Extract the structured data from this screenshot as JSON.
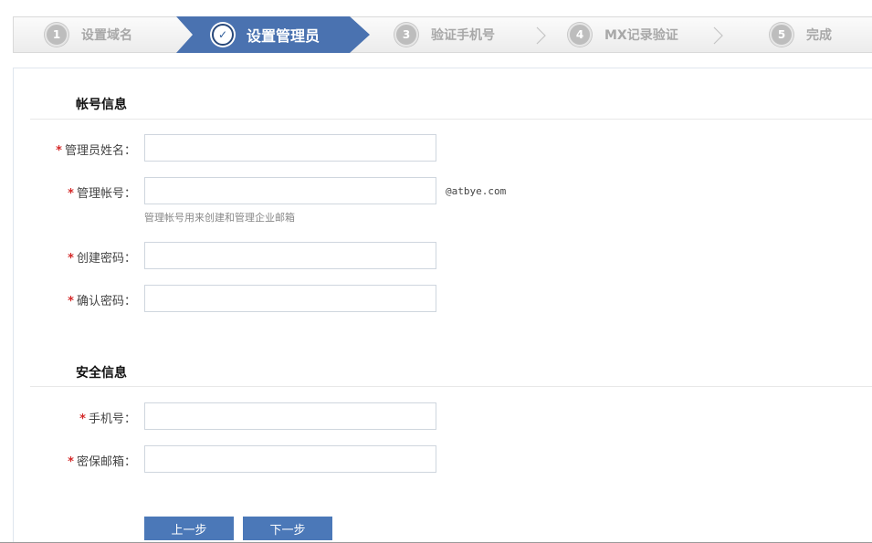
{
  "wizard": {
    "steps": [
      {
        "number": "1",
        "label": "设置域名",
        "state": "done"
      },
      {
        "number": "✓",
        "label": "设置管理员",
        "state": "active"
      },
      {
        "number": "3",
        "label": "验证手机号",
        "state": "pending"
      },
      {
        "number": "4",
        "label": "MX记录验证",
        "state": "pending"
      },
      {
        "number": "5",
        "label": "完成",
        "state": "pending"
      }
    ]
  },
  "account_section": {
    "title": "帐号信息",
    "fields": {
      "admin_name": {
        "label": "管理员姓名：",
        "value": "",
        "placeholder": ""
      },
      "admin_account": {
        "label": "管理帐号：",
        "value": "",
        "placeholder": "",
        "suffix": "@atbye.com",
        "hint": "管理帐号用来创建和管理企业邮箱"
      },
      "password": {
        "label": "创建密码：",
        "value": "",
        "placeholder": ""
      },
      "confirm_password": {
        "label": "确认密码：",
        "value": "",
        "placeholder": ""
      }
    }
  },
  "security_section": {
    "title": "安全信息",
    "fields": {
      "phone": {
        "label": "手机号：",
        "value": "",
        "placeholder": ""
      },
      "security_email": {
        "label": "密保邮箱：",
        "value": "",
        "placeholder": ""
      }
    }
  },
  "buttons": {
    "prev": "上一步",
    "next": "下一步"
  },
  "required_mark": "*",
  "colors": {
    "accent": "#4a72b0",
    "button": "#4b78b8",
    "required": "#d42a2a",
    "step_inactive": "#a8a8a8"
  }
}
